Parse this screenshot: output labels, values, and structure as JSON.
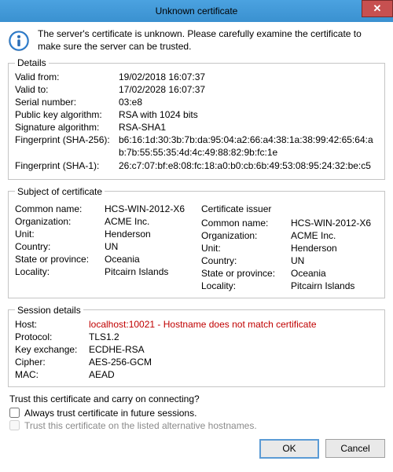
{
  "window": {
    "title": "Unknown certificate",
    "close_glyph": "✕"
  },
  "message": "The server's certificate is unknown. Please carefully examine the certificate to make sure the server can be trusted.",
  "details": {
    "legend": "Details",
    "valid_from_label": "Valid from:",
    "valid_from": "19/02/2018 16:07:37",
    "valid_to_label": "Valid to:",
    "valid_to": "17/02/2028 16:07:37",
    "serial_label": "Serial number:",
    "serial": "03:e8",
    "pubkey_label": "Public key algorithm:",
    "pubkey": "RSA with 1024 bits",
    "sigalg_label": "Signature algorithm:",
    "sigalg": "RSA-SHA1",
    "fp256_label": "Fingerprint (SHA-256):",
    "fp256": "b6:16:1d:30:3b:7b:da:95:04:a2:66:a4:38:1a:38:99:42:65:64:ab:7b:55:55:35:4d:4c:49:88:82:9b:fc:1e",
    "fp1_label": "Fingerprint (SHA-1):",
    "fp1": "26:c7:07:bf:e8:08:fc:18:a0:b0:cb:6b:49:53:08:95:24:32:be:c5"
  },
  "subject": {
    "legend": "Subject of certificate",
    "common_name_label": "Common name:",
    "common_name": "HCS-WIN-2012-X6",
    "organization_label": "Organization:",
    "organization": "ACME Inc.",
    "unit_label": "Unit:",
    "unit": "Henderson",
    "country_label": "Country:",
    "country": "UN",
    "state_label": "State or province:",
    "state": "Oceania",
    "locality_label": "Locality:",
    "locality": "Pitcairn Islands"
  },
  "issuer": {
    "legend": "Certificate issuer",
    "common_name_label": "Common name:",
    "common_name": "HCS-WIN-2012-X6",
    "organization_label": "Organization:",
    "organization": "ACME Inc.",
    "unit_label": "Unit:",
    "unit": "Henderson",
    "country_label": "Country:",
    "country": "UN",
    "state_label": "State or province:",
    "state": "Oceania",
    "locality_label": "Locality:",
    "locality": "Pitcairn Islands"
  },
  "session": {
    "legend": "Session details",
    "host_label": "Host:",
    "host": "localhost:10021 - Hostname does not match certificate",
    "protocol_label": "Protocol:",
    "protocol": "TLS1.2",
    "keyexchange_label": "Key exchange:",
    "keyexchange": "ECDHE-RSA",
    "cipher_label": "Cipher:",
    "cipher": "AES-256-GCM",
    "mac_label": "MAC:",
    "mac": "AEAD"
  },
  "prompt": {
    "question": "Trust this certificate and carry on connecting?",
    "always_trust": "Always trust certificate in future sessions.",
    "alt_trust": "Trust this certificate on the listed alternative hostnames."
  },
  "buttons": {
    "ok": "OK",
    "cancel": "Cancel"
  }
}
